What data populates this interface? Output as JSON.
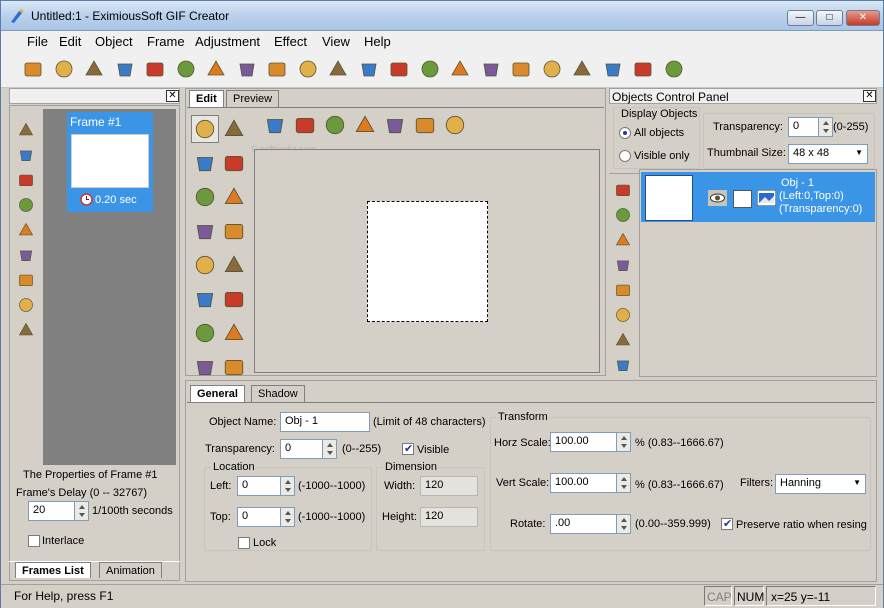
{
  "window": {
    "title": "Untitled:1 - EximiousSoft GIF Creator"
  },
  "window_buttons": {
    "minimize": "—",
    "maximize": "□",
    "close": "✕"
  },
  "menu": [
    "File",
    "Edit",
    "Object",
    "Frame",
    "Adjustment",
    "Effect",
    "View",
    "Help"
  ],
  "toolbar_icons": [
    "new-icon",
    "open-icon",
    "avi-icon",
    "film-icon",
    "film-strip-icon",
    "print-icon",
    "undo-icon",
    "redo-icon",
    "cut-icon",
    "copy-icon",
    "paste-icon",
    "delete-icon",
    "tag-icon",
    "image-icon",
    "wand-icon",
    "cursor-icon",
    "brush-icon",
    "circle-icon",
    "person-icon",
    "phone-icon",
    "cube-icon",
    "arrow-icon"
  ],
  "frames_panel": {
    "frame_label": "Frame #1",
    "frame_delay": "0.20 sec",
    "tools": [
      "add-frame-icon",
      "edit-frame-icon",
      "copy-frame-icon",
      "delete-frame-icon",
      "film-icon",
      "film-icon",
      "film-icon",
      "film-icon",
      "film-icon"
    ]
  },
  "frame_props": {
    "title": "The Properties of Frame #1",
    "delay_label": "Frame's Delay (0 -- 32767)",
    "delay_value": "20",
    "delay_unit": "1/100th seconds",
    "interlace_label": "Interlace"
  },
  "left_tabs": {
    "frames_list": "Frames List",
    "animation": "Animation"
  },
  "edit_tabs": {
    "edit": "Edit",
    "preview": "Preview"
  },
  "watermark": "© softpedia.com",
  "objects_panel": {
    "title": "Objects Control Panel",
    "display_title": "Display Objects",
    "all_objects": "All objects",
    "visible_only": "Visible only",
    "transparency_label": "Transparency:",
    "transparency_value": "0",
    "transparency_range": "(0-255)",
    "thumb_label": "Thumbnail Size:",
    "thumb_value": "48 x 48",
    "obj_name": "Obj - 1",
    "obj_pos": "(Left:0,Top:0)",
    "obj_trans": "(Transparency:0)"
  },
  "prop_tabs": {
    "general": "General",
    "shadow": "Shadow"
  },
  "general": {
    "name_label": "Object Name:",
    "name_value": "Obj - 1",
    "name_limit": "(Limit of 48 characters)",
    "trans_label": "Transparency:",
    "trans_value": "0",
    "trans_range": "(0--255)",
    "visible_label": "Visible",
    "location_title": "Location",
    "left_label": "Left:",
    "left_value": "0",
    "left_range": "(-1000--1000)",
    "top_label": "Top:",
    "top_value": "0",
    "top_range": "(-1000--1000)",
    "lock_label": "Lock",
    "dimension_title": "Dimension",
    "width_label": "Width:",
    "width_value": "120",
    "height_label": "Height:",
    "height_value": "120",
    "transform_title": "Transform",
    "horz_label": "Horz Scale:",
    "horz_value": "100.00",
    "horz_range": "% (0.83--1666.67)",
    "vert_label": "Vert Scale:",
    "vert_value": "100.00",
    "vert_range": "% (0.83--1666.67)",
    "filters_label": "Filters:",
    "filters_value": "Hanning",
    "rotate_label": "Rotate:",
    "rotate_value": ".00",
    "rotate_range": "(0.00--359.999)",
    "preserve_label": "Preserve ratio when resing"
  },
  "status": {
    "help": "For Help, press F1",
    "cap": "CAP",
    "num": "NUM",
    "coords": "x=25 y=-11"
  }
}
